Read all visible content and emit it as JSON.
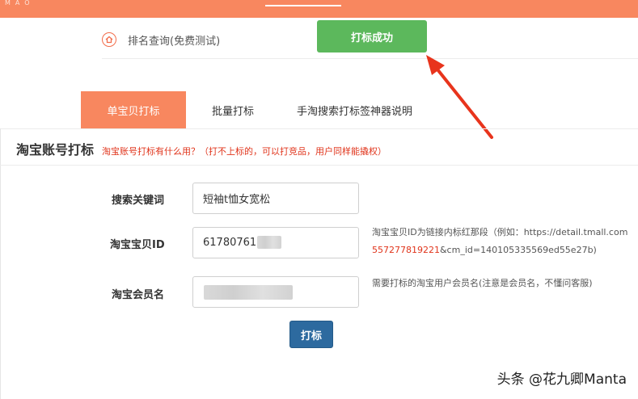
{
  "topbar": {
    "brand": "MAO"
  },
  "rank": {
    "label": "排名查询(免费测试)"
  },
  "success_button": {
    "label": "打标成功",
    "color": "#5cb85c"
  },
  "tabs": [
    {
      "label": "单宝贝打标",
      "active": true
    },
    {
      "label": "批量打标",
      "active": false
    },
    {
      "label": "手淘搜索打标签神器说明",
      "active": false
    }
  ],
  "panel": {
    "title": "淘宝账号打标",
    "hint": "淘宝账号打标有什么用？（打不上标的，可以打竞品，用户同样能撬权）"
  },
  "form": {
    "keyword": {
      "label": "搜索关键词",
      "value": "短袖t恤女宽松"
    },
    "item_id": {
      "label": "淘宝宝贝ID",
      "value": "61780761",
      "help_line1": "淘宝宝贝ID为链接内标红那段（例如：https://detail.tmall.com",
      "help_red": "557277819221",
      "help_line2": "&cm_id=140105335569ed55e27b)"
    },
    "member": {
      "label": "淘宝会员名",
      "value": "",
      "help": "需要打标的淘宝用户会员名(注意是会员名，不懂问客服)"
    },
    "submit_label": "打标"
  },
  "watermark": "头条 @花九卿Manta",
  "colors": {
    "accent": "#f8875f",
    "submit": "#2d6a9f",
    "hint": "#e0341b",
    "arrow": "#e8341c"
  }
}
